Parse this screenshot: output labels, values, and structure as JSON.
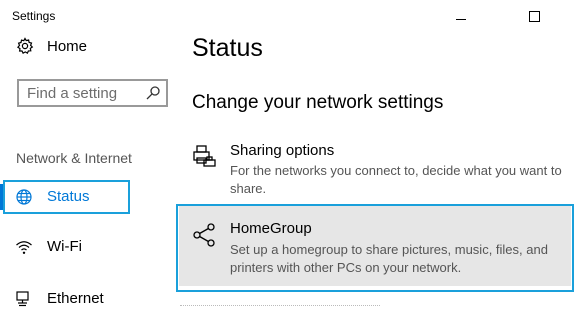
{
  "window": {
    "title": "Settings",
    "minimize_icon": "minimize-icon",
    "maximize_icon": "maximize-icon"
  },
  "sidebar": {
    "home": {
      "label": "Home",
      "icon": "gear-icon"
    },
    "search": {
      "placeholder": "Find a setting",
      "value": "",
      "icon": "search-icon"
    },
    "section_heading": "Network & Internet",
    "items": [
      {
        "label": "Status",
        "icon": "globe-icon",
        "selected": true
      },
      {
        "label": "Wi-Fi",
        "icon": "wifi-icon",
        "selected": false
      },
      {
        "label": "Ethernet",
        "icon": "ethernet-icon",
        "selected": false
      }
    ]
  },
  "main": {
    "title": "Status",
    "section_title": "Change your network settings",
    "options": [
      {
        "title": "Sharing options",
        "description": "For the networks you connect to, decide what you want to share.",
        "icon": "printer-share-icon"
      },
      {
        "title": "HomeGroup",
        "description": "Set up a homegroup to share pictures, music, files, and printers with other PCs on your network.",
        "icon": "homegroup-icon"
      }
    ]
  },
  "colors": {
    "accent": "#0078d7",
    "highlight_border": "#1aa0db",
    "hover_background": "#e6e6e6",
    "secondary_text": "#555555"
  }
}
